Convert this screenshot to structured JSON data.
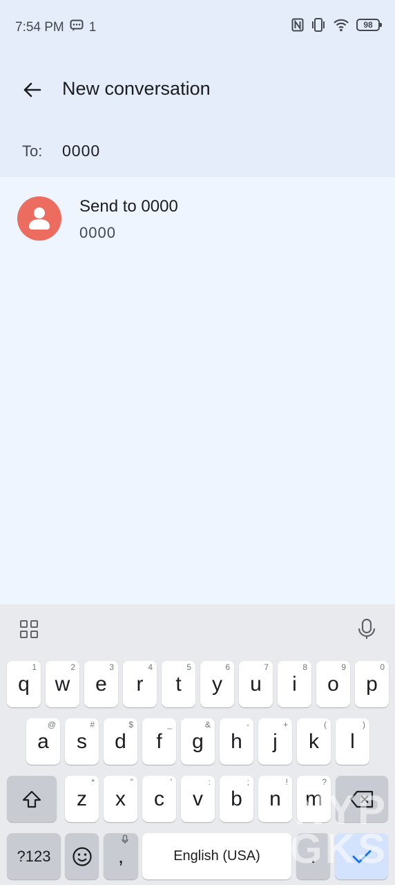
{
  "status_bar": {
    "time": "7:54 PM",
    "notification_count": "1",
    "battery": "98"
  },
  "header": {
    "title": "New conversation"
  },
  "recipient": {
    "to_label": "To:",
    "to_value": "0000"
  },
  "suggestion": {
    "name": "Send to 0000",
    "number": "0000"
  },
  "keyboard": {
    "row1": [
      {
        "k": "q",
        "h": "1"
      },
      {
        "k": "w",
        "h": "2"
      },
      {
        "k": "e",
        "h": "3"
      },
      {
        "k": "r",
        "h": "4"
      },
      {
        "k": "t",
        "h": "5"
      },
      {
        "k": "y",
        "h": "6"
      },
      {
        "k": "u",
        "h": "7"
      },
      {
        "k": "i",
        "h": "8"
      },
      {
        "k": "o",
        "h": "9"
      },
      {
        "k": "p",
        "h": "0"
      }
    ],
    "row2": [
      {
        "k": "a",
        "h": "@"
      },
      {
        "k": "s",
        "h": "#"
      },
      {
        "k": "d",
        "h": "$"
      },
      {
        "k": "f",
        "h": "_"
      },
      {
        "k": "g",
        "h": "&"
      },
      {
        "k": "h",
        "h": "-"
      },
      {
        "k": "j",
        "h": "+"
      },
      {
        "k": "k",
        "h": "("
      },
      {
        "k": "l",
        "h": ")"
      }
    ],
    "row3": [
      {
        "k": "z",
        "h": "*"
      },
      {
        "k": "x",
        "h": "\""
      },
      {
        "k": "c",
        "h": "'"
      },
      {
        "k": "v",
        "h": ":"
      },
      {
        "k": "b",
        "h": ";"
      },
      {
        "k": "n",
        "h": "!"
      },
      {
        "k": "m",
        "h": "?"
      }
    ],
    "symbols_label": "?123",
    "comma": ",",
    "space_label": "English (USA)",
    "period": "."
  },
  "watermark": {
    "line1": "NYP",
    "line2": "GKS"
  },
  "colors": {
    "header_bg": "#e5ecfa",
    "body_bg": "#eef5fe",
    "avatar": "#ec6d60",
    "accent": "#1a73e8"
  }
}
